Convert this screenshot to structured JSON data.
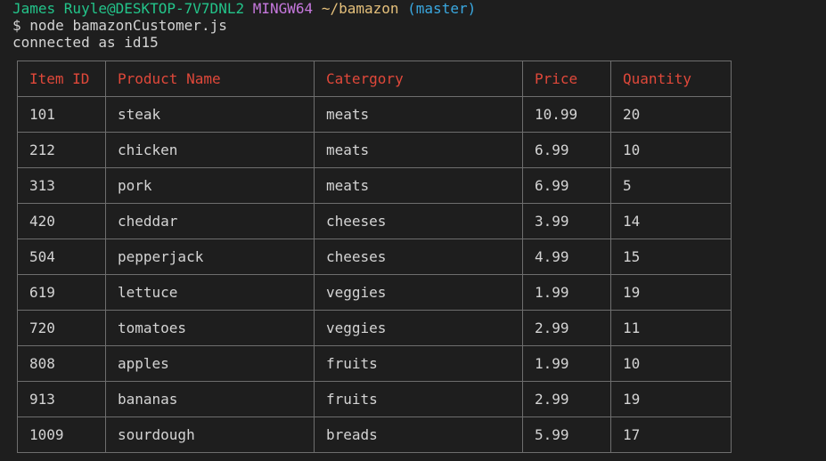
{
  "prompt": {
    "user_host": "James Ruyle@DESKTOP-7V7DNL2",
    "system": "MINGW64",
    "path": "~/bamazon",
    "branch": "(master)"
  },
  "command": {
    "dollar": "$",
    "text": "node bamazonCustomer.js"
  },
  "output": {
    "connected": "connected as id15"
  },
  "table": {
    "headers": [
      "Item ID",
      "Product Name",
      "Catergory",
      "Price",
      "Quantity"
    ],
    "rows": [
      [
        "101",
        "steak",
        "meats",
        "10.99",
        "20"
      ],
      [
        "212",
        "chicken",
        "meats",
        "6.99",
        "10"
      ],
      [
        "313",
        "pork",
        "meats",
        "6.99",
        "5"
      ],
      [
        "420",
        "cheddar",
        "cheeses",
        "3.99",
        "14"
      ],
      [
        "504",
        "pepperjack",
        "cheeses",
        "4.99",
        "15"
      ],
      [
        "619",
        "lettuce",
        "veggies",
        "1.99",
        "19"
      ],
      [
        "720",
        "tomatoes",
        "veggies",
        "2.99",
        "11"
      ],
      [
        "808",
        "apples",
        "fruits",
        "1.99",
        "10"
      ],
      [
        "913",
        "bananas",
        "fruits",
        "2.99",
        "19"
      ],
      [
        "1009",
        "sourdough",
        "breads",
        "5.99",
        "17"
      ]
    ]
  },
  "colors": {
    "background": "#1e1e1e",
    "text": "#d4d4d4",
    "user_host": "#23c48a",
    "system": "#c678dd",
    "path": "#e5c07b",
    "branch": "#3aa8e0",
    "header": "#e0483a",
    "border": "#6e6e6e"
  }
}
